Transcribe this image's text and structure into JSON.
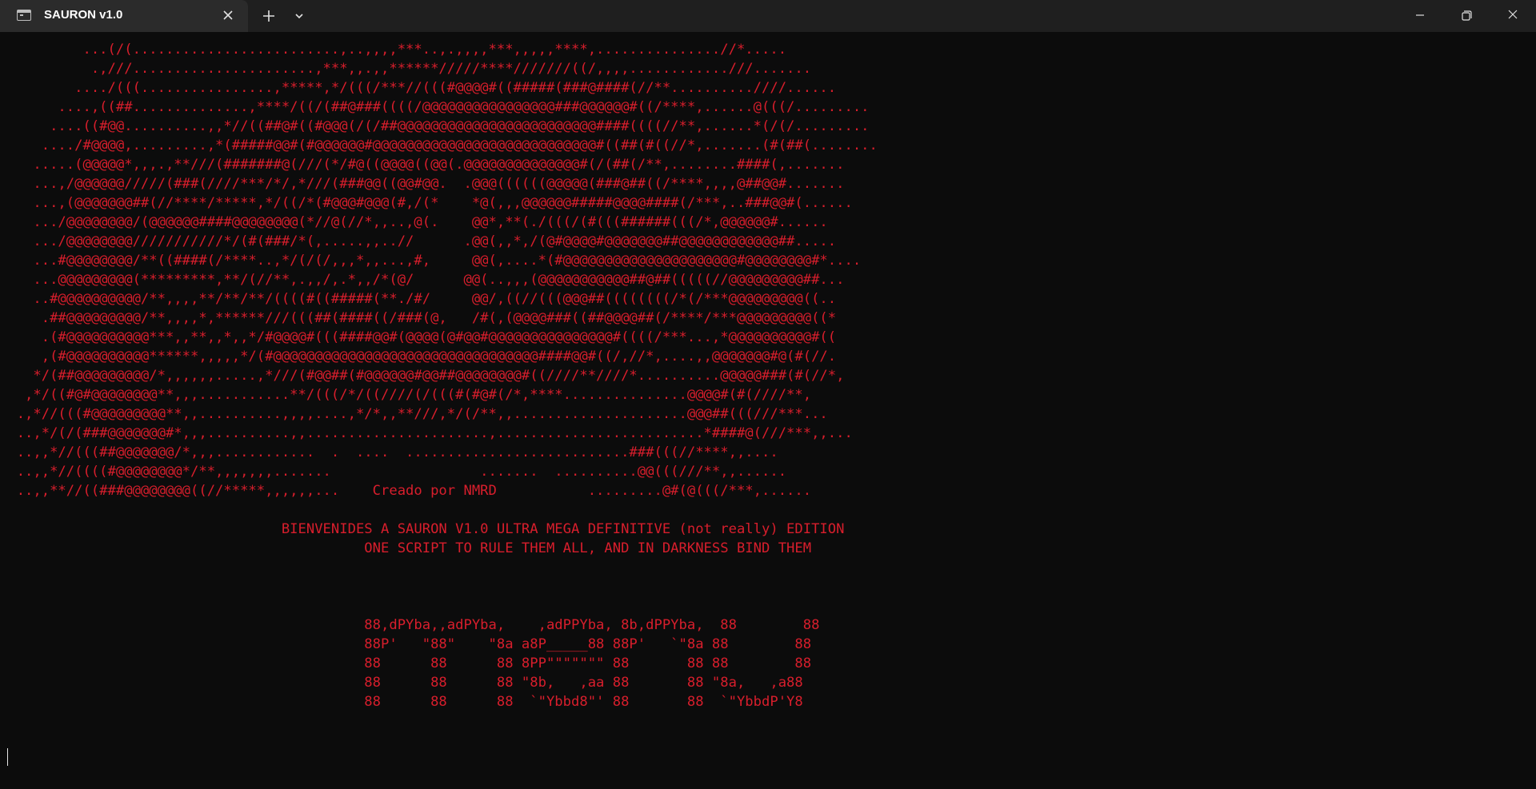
{
  "window": {
    "title": "SAURON v1.0",
    "tab_icon": "terminal-icon",
    "close_tab_icon": "close-icon",
    "new_tab_icon": "plus-icon",
    "dropdown_icon": "chevron-down-icon",
    "controls": [
      "minimize-icon",
      "maximize-icon",
      "close-icon"
    ]
  },
  "terminal": {
    "text_color": "#d81e2c",
    "background": "#0c0c0c",
    "eye_art": "          ...(/(.........................,..,,,,***..,.,,,,***,,,,,****,...............//*.....\n           .,///......................,***,,.,,******/////****///////((/,,,,............///.......\n         ..../(((................,*****,*/(((/***//(((#@@@@#((#####(###@####(//**..........////......\n       ....,((##..............,****/((/(##@###((((/@@@@@@@@@@@@@@@@###@@@@@@#((/****,......@(((/.........\n      ....((#@@..........,,*//((##@#((#@@@(/(/##@@@@@@@@@@@@@@@@@@@@@@@@####((((//**,......*(/(/.........\n     ..../#@@@@,.........,*(#####@@#(#@@@@@@#@@@@@@@@@@@@@@@@@@@@@@@@@@@#((##(#((//*,.......(#(##(........\n    .....(@@@@@*,,,.,**///(#######@(///(*/#@((@@@@((@@(.@@@@@@@@@@@@@@#(/(##(/**,........####(,.......\n    ...,/@@@@@@/////(###(////***/*/,*///(###@@((@@#@@.  .@@@((((((@@@@@(###@##((/****,,,,@##@@#.......\n    ...,(@@@@@@@##(//****/*****,*/((/*(#@@@#@@@(#,/(*    *@(,,,@@@@@@#####@@@@####(/***,..###@@#(......\n    .../@@@@@@@@/(@@@@@@####@@@@@@@@(*//@(//*,,..,@(.    @@*,**(./(((/(#(((######(((/*,@@@@@@#......\n    .../@@@@@@@@///////////*/(#(###/*(,.....,,..//      .@@(,,*,/(@#@@@@#@@@@@@@##@@@@@@@@@@@@##.....\n    ...#@@@@@@@@/**((####(/****..,*/(/(/,,,*,,...,#,     @@(,....*(#@@@@@@@@@@@@@@@@@@@@@#@@@@@@@@#*....\n    ...@@@@@@@@@(*********,**/(//**,.,,/,.*,,/*(@/      @@(..,,,(@@@@@@@@@@@##@##(((((//@@@@@@@@@##...\n    ..#@@@@@@@@@@/**,,,,**/**/**/((((#((#####(**./#/     @@/,((//(((@@@##((((((((/*(/***@@@@@@@@@((..\n     .##@@@@@@@@@/**,,,,*,******///(((##(####((/###(@,   /#(,(@@@@###((##@@@@##(/****/***@@@@@@@@@((*\n     .(#@@@@@@@@@@***,,**,,*,,*/#@@@@#(((####@@#(@@@@(@#@@#@@@@@@@@@@@@@@@#((((/***...,*@@@@@@@@@@#((\n     ,(#@@@@@@@@@@******,,,,,*/(#@@@@@@@@@@@@@@@@@@@@@@@@@@@@@@@@####@@#((/,//*,....,,@@@@@@@#@(#(//.\n    */(##@@@@@@@@@/*,,,,,,.....,*///(#@@##(#@@@@@@#@@##@@@@@@@@#((////**////*..........@@@@@###(#(//*,\n   ,*/((#@#@@@@@@@@**,,,...........**/(((/*/((////(/(((#(#@#(/*,****...............@@@@#(#(////**,\n  .,*//(((#@@@@@@@@@**,,..........,,,,....,*/*,,**///,*/(/**,,.....................@@@##(((///***...\n  ..,*/(/(###@@@@@@@#*,,,..........,,......................,.........................*####@(///***,,...\n  ..,,*//(((##@@@@@@@/*,,,............  .  ....  ...........................###(((//****,,....\n  ..,,*//((((#@@@@@@@@*/**,,,,,,,.......                  .......  ..........@@(((///**,,......\n  ..,,**//((###@@@@@@@@((//*****,,,,,,...    Creado por NMRD           .........@#(@(((/***,......",
    "welcome_text": "                                  BIENVENIDES A SAURON V1.0 ULTRA MEGA DEFINITIVE (not really) EDITION\n                                            ONE SCRIPT TO RULE THEM ALL, AND IN DARKNESS BIND THEM",
    "logo_art": "                                            88,dPYba,,adPYba,    ,adPPYba, 8b,dPPYba,  88        88\n                                            88P'   \"88\"    \"8a a8P_____88 88P'   `\"8a 88        88\n                                            88      88      88 8PP\"\"\"\"\"\"\" 88       88 88        88\n                                            88      88      88 \"8b,   ,aa 88       88 \"8a,   ,a88\n                                            88      88      88  `\"Ybbd8\"' 88       88  `\"YbbdP'Y8"
  }
}
